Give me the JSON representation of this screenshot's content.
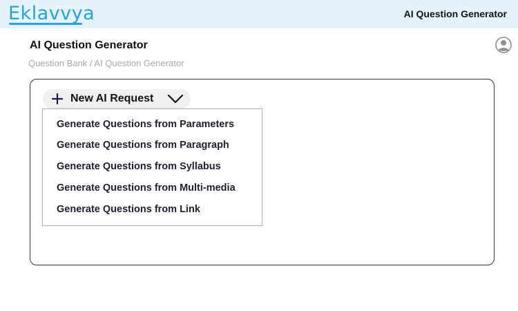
{
  "header": {
    "logo_text": "Eklavvya",
    "title": "AI Question Generator",
    "brand_color": "#2aa1d8",
    "background_color": "#e3f2fb"
  },
  "page": {
    "title": "AI Question Generator",
    "breadcrumb": "Question Bank / AI Question Generator"
  },
  "user": {
    "avatar_icon": "user-avatar-icon"
  },
  "new_request": {
    "label": "New AI Request",
    "icon_left": "plus-icon",
    "icon_right": "chevron-down-icon",
    "menu_items": [
      "Generate Questions from Parameters",
      "Generate Questions from Paragraph",
      "Generate Questions from Syllabus",
      "Generate Questions from Multi-media",
      "Generate Questions from Link"
    ]
  }
}
